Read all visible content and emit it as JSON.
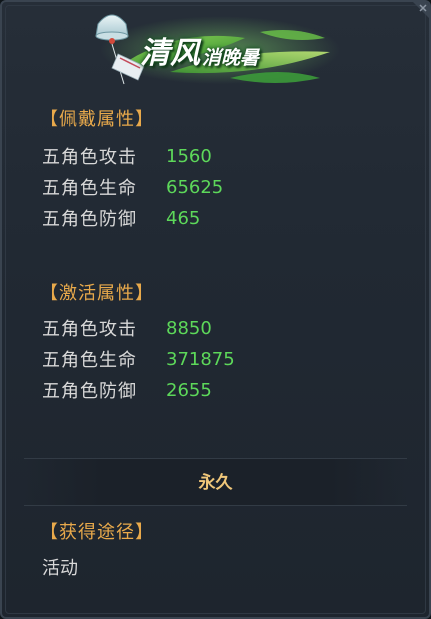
{
  "banner": {
    "title_big": "清风",
    "title_small": "消晚暑"
  },
  "equip_section": {
    "header": "【佩戴属性】",
    "rows": [
      {
        "label": "五角色攻击",
        "value": "1560"
      },
      {
        "label": "五角色生命",
        "value": "65625"
      },
      {
        "label": "五角色防御",
        "value": "465"
      }
    ]
  },
  "activate_section": {
    "header": "【激活属性】",
    "rows": [
      {
        "label": "五角色攻击",
        "value": "8850"
      },
      {
        "label": "五角色生命",
        "value": "371875"
      },
      {
        "label": "五角色防御",
        "value": "2655"
      }
    ]
  },
  "duration": "永久",
  "source_section": {
    "header": "【获得途径】",
    "text": "活动"
  },
  "colors": {
    "section_header": "#e8a94b",
    "value_green": "#5dd85a",
    "duration_gold": "#f0c77a",
    "panel_bg": "#232b35"
  },
  "icons": {
    "banner": "wind-chime-leaves-icon",
    "corner": "close-corner-icon"
  }
}
